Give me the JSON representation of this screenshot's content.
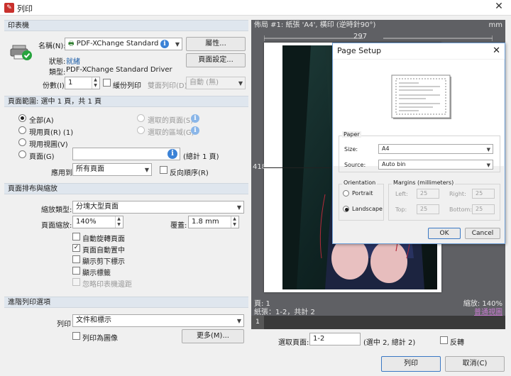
{
  "window": {
    "title": "列印",
    "close_glyph": "✕"
  },
  "printer": {
    "section": "印表機",
    "name_label": "名稱(N):",
    "name_value": "PDF-XChange Standard",
    "properties_btn": "屬性...",
    "status_label": "狀態:",
    "status_value": "就緒",
    "type_label": "類型:",
    "type_value": "PDF-XChange Standard Driver",
    "page_setup_btn": "頁面設定...",
    "copies_label": "份數(I):",
    "copies_value": "1",
    "collate_label": "緩份列印",
    "duplex_label": "雙面列印(D)",
    "duplex_value": "自動 (無)"
  },
  "range": {
    "section": "頁面範圍: 選中 1 頁，共 1 頁",
    "all": "全部(A)",
    "current_page": "現用頁(R) (1)",
    "current_view": "現用視圖(V)",
    "pages": "頁面(G)",
    "pages_total": "(總計 1 頁)",
    "selected_pages": "選取的頁面(S)",
    "selected_area": "選取的區域(G)",
    "apply_label": "應用到:",
    "apply_value": "所有頁面",
    "reverse_label": "反向順序(R)"
  },
  "layout": {
    "section": "頁面排布與縮放",
    "scale_type_label": "縮放類型:",
    "scale_type_value": "分塊大型頁面",
    "zoom_label": "頁面縮放:",
    "zoom_value": "140%",
    "overlap_label": "覆蓋:",
    "overlap_value": "1.8 mm",
    "opt_autorotate": "自動旋轉頁面",
    "opt_autocenter": "頁面自動置中",
    "opt_cutmarks": "顯示剪下標示",
    "opt_labels": "顯示標籤",
    "opt_ignore_margins": "忽略印表機邊距"
  },
  "advanced": {
    "section": "進階列印選項",
    "print_label": "列印",
    "print_value": "文件和標示",
    "as_image_label": "列印為圖像",
    "more_btn": "更多(M)..."
  },
  "preview": {
    "header": "佈局 #1: 紙張 'A4', 橫印 (逆時針90°)",
    "unit": "mm",
    "width_mm": "297",
    "height_mm": "418.2",
    "page_label": "頁: 1",
    "sheets_label": "紙張：1-2，共計 2",
    "zoom_label": "縮放: 140%",
    "fit_link": "普通視圖",
    "thumb_page": "1"
  },
  "bottom": {
    "select_pages_label": "選取頁面:",
    "select_pages_value": "1-2",
    "select_pages_info": "(選中 2, 總計 2)",
    "reverse_label": "反轉",
    "print_btn": "列印",
    "cancel_btn": "取消(C)"
  },
  "page_setup": {
    "title": "Page Setup",
    "paper_group": "Paper",
    "size_label": "Size:",
    "size_value": "A4",
    "source_label": "Source:",
    "source_value": "Auto bin",
    "orientation_group": "Orientation",
    "portrait": "Portrait",
    "landscape": "Landscape",
    "margins_group": "Margins (millimeters)",
    "left_label": "Left:",
    "left_value": "25",
    "right_label": "Right:",
    "right_value": "25",
    "top_label": "Top:",
    "top_value": "25",
    "bottom_label": "Bottom:",
    "bottom_value": "25",
    "ok": "OK",
    "cancel": "Cancel"
  },
  "colors": {
    "accent": "#1f5fa8",
    "section_bg": "#dfe6ee",
    "preview_bg": "#5f6064",
    "dialog_border": "#6fa0d8"
  }
}
